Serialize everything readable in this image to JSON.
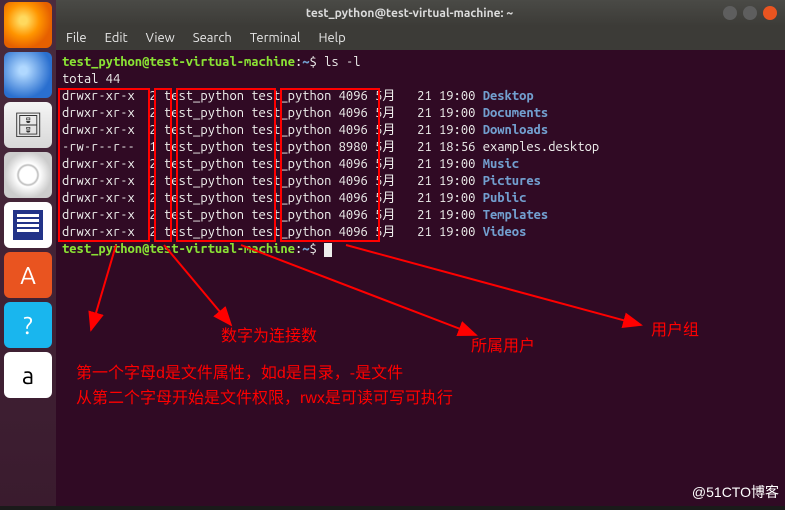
{
  "titlebar": {
    "title": "test_python@test-virtual-machine: ~"
  },
  "menubar": [
    "File",
    "Edit",
    "View",
    "Search",
    "Terminal",
    "Help"
  ],
  "prompt": {
    "user": "test_python",
    "at": "@",
    "host": "test-virtual-machine",
    "colon": ":",
    "path": "~",
    "dollar": "$"
  },
  "command": "ls -l",
  "total_line": "total 44",
  "files": [
    {
      "perm": "drwxr-xr-x",
      "links": "2",
      "owner": "test_python",
      "group": "test_python",
      "size": "4096",
      "month": "5月",
      "day": "21",
      "time": "19:00",
      "name": "Desktop",
      "dir": true
    },
    {
      "perm": "drwxr-xr-x",
      "links": "2",
      "owner": "test_python",
      "group": "test_python",
      "size": "4096",
      "month": "5月",
      "day": "21",
      "time": "19:00",
      "name": "Documents",
      "dir": true
    },
    {
      "perm": "drwxr-xr-x",
      "links": "2",
      "owner": "test_python",
      "group": "test_python",
      "size": "4096",
      "month": "5月",
      "day": "21",
      "time": "19:00",
      "name": "Downloads",
      "dir": true
    },
    {
      "perm": "-rw-r--r--",
      "links": "1",
      "owner": "test_python",
      "group": "test_python",
      "size": "8980",
      "month": "5月",
      "day": "21",
      "time": "18:56",
      "name": "examples.desktop",
      "dir": false
    },
    {
      "perm": "drwxr-xr-x",
      "links": "2",
      "owner": "test_python",
      "group": "test_python",
      "size": "4096",
      "month": "5月",
      "day": "21",
      "time": "19:00",
      "name": "Music",
      "dir": true
    },
    {
      "perm": "drwxr-xr-x",
      "links": "2",
      "owner": "test_python",
      "group": "test_python",
      "size": "4096",
      "month": "5月",
      "day": "21",
      "time": "19:00",
      "name": "Pictures",
      "dir": true
    },
    {
      "perm": "drwxr-xr-x",
      "links": "2",
      "owner": "test_python",
      "group": "test_python",
      "size": "4096",
      "month": "5月",
      "day": "21",
      "time": "19:00",
      "name": "Public",
      "dir": true
    },
    {
      "perm": "drwxr-xr-x",
      "links": "2",
      "owner": "test_python",
      "group": "test_python",
      "size": "4096",
      "month": "5月",
      "day": "21",
      "time": "19:00",
      "name": "Templates",
      "dir": true
    },
    {
      "perm": "drwxr-xr-x",
      "links": "2",
      "owner": "test_python",
      "group": "test_python",
      "size": "4096",
      "month": "5月",
      "day": "21",
      "time": "19:00",
      "name": "Videos",
      "dir": true
    }
  ],
  "annotations": {
    "link_count": "数字为连接数",
    "owner": "所属用户",
    "group": "用户组",
    "explain1": "第一个字母d是文件属性，如d是目录，-是文件",
    "explain2": "从第二个字母开始是文件权限，rwx是可读可写可执行"
  },
  "watermark": "@51CTO博客",
  "launcher_items": [
    {
      "name": "firefox",
      "cls": "ffox",
      "glyph": ""
    },
    {
      "name": "thunderbird",
      "cls": "mail",
      "glyph": ""
    },
    {
      "name": "files",
      "cls": "files",
      "glyph": "🗄"
    },
    {
      "name": "rhythmbox",
      "cls": "disk",
      "glyph": ""
    },
    {
      "name": "writer",
      "cls": "writer",
      "glyph": ""
    },
    {
      "name": "software",
      "cls": "store",
      "glyph": "A"
    },
    {
      "name": "help",
      "cls": "help",
      "glyph": "?"
    },
    {
      "name": "amazon",
      "cls": "amz",
      "glyph": "a"
    }
  ]
}
